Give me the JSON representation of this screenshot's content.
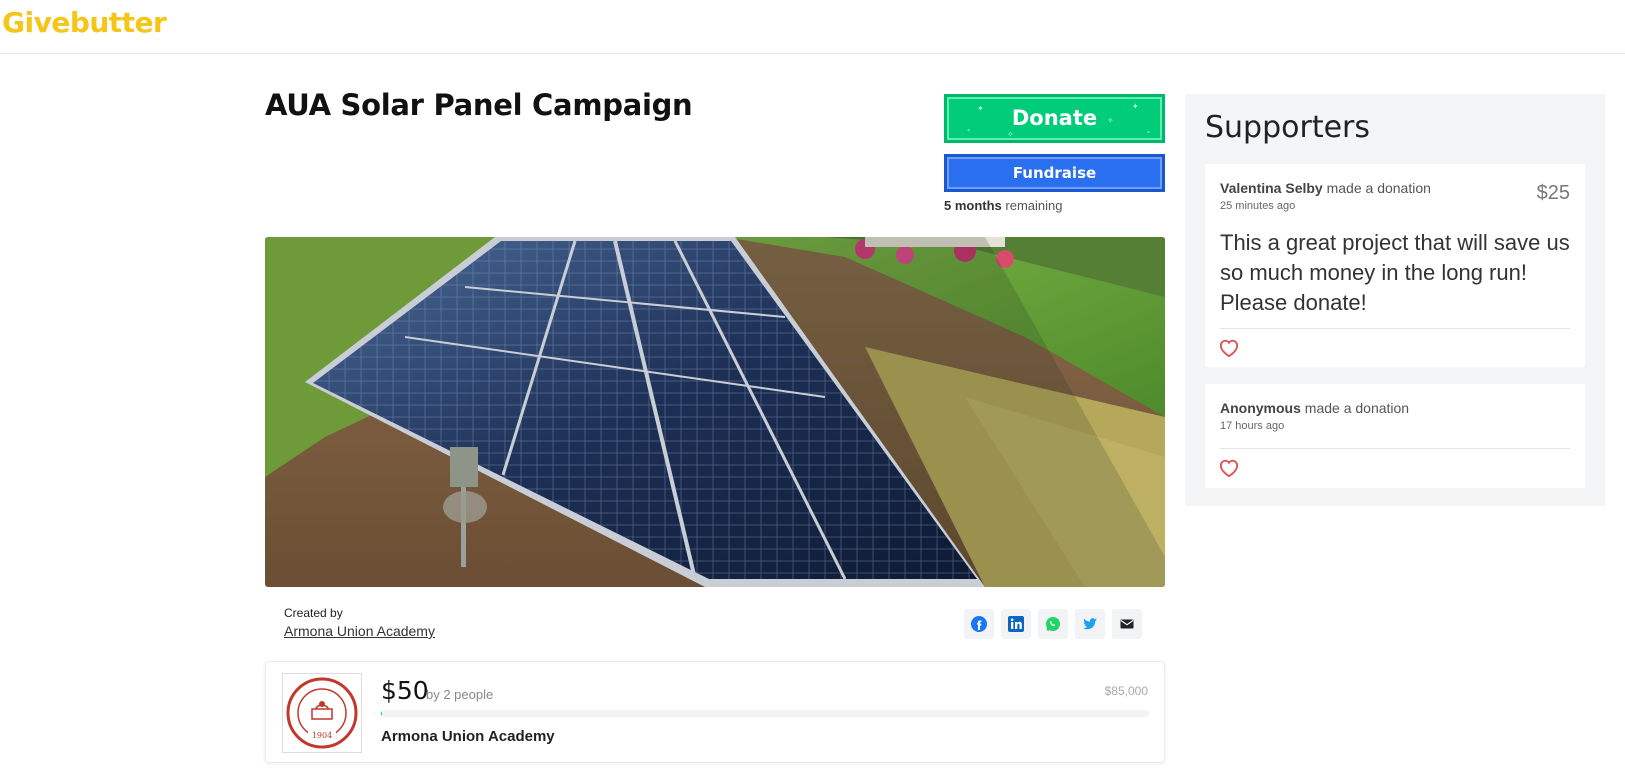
{
  "header": {
    "logo": "Givebutter"
  },
  "campaign": {
    "title": "AUA Solar Panel Campaign",
    "donate_label": "Donate",
    "fundraise_label": "Fundraise",
    "remaining_bold": "5 months",
    "remaining_rest": " remaining",
    "created_by_label": "Created by",
    "creator": "Armona Union Academy",
    "share_icons": [
      "facebook-icon",
      "linkedin-icon",
      "whatsapp-icon",
      "twitter-icon",
      "email-icon"
    ]
  },
  "progress": {
    "raised": "$50",
    "by": "by 2 people",
    "goal": "$85,000",
    "fraction": 0.0006,
    "org_name": "Armona Union Academy",
    "logo_text": "ARMONA UNION ACADEMY",
    "logo_year": "1904"
  },
  "supporters": {
    "title": "Supporters",
    "items": [
      {
        "name": "Valentina Selby",
        "action": " made a donation",
        "time": "25 minutes ago",
        "amount": "$25",
        "message": "This a great project that will save us so much money in the long run! Please donate!"
      },
      {
        "name": "Anonymous",
        "action": " made a donation",
        "time": "17 hours ago"
      }
    ]
  },
  "colors": {
    "brand": "#f5c518",
    "donate": "#00cc7a",
    "fundraise": "#2a6ff0",
    "heart": "#d9534f"
  }
}
